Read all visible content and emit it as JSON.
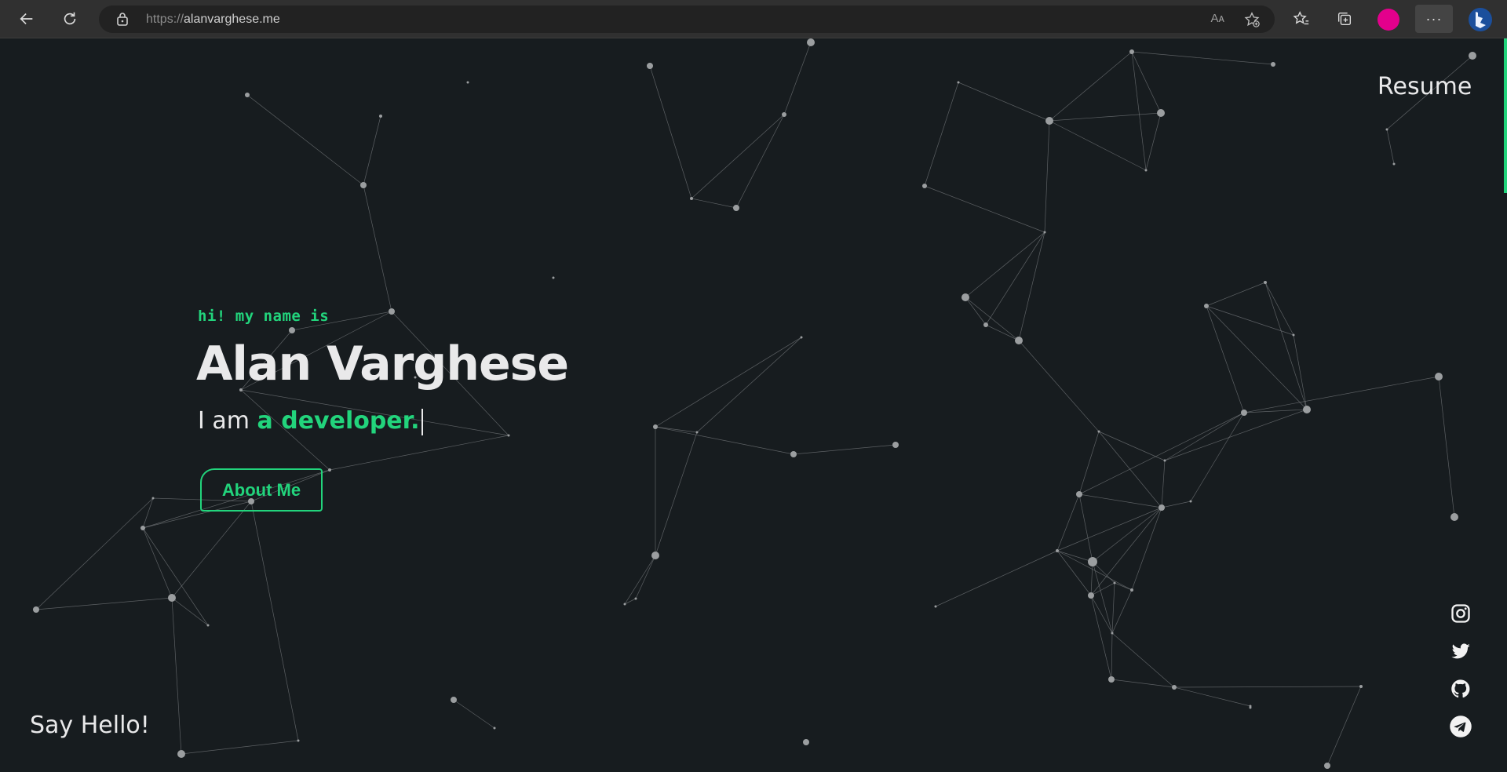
{
  "browser": {
    "url_protocol": "https://",
    "url_host": "alanvarghese.me",
    "read_aloud_icon": "Aᴀ"
  },
  "hero": {
    "greeting": "hi! my name is",
    "name": "Alan Varghese",
    "role_prefix": "I am ",
    "role_highlight": "a developer.",
    "about_button": "About Me"
  },
  "nav": {
    "resume": "Resume",
    "say_hello": "Say Hello!"
  },
  "socials": [
    "instagram-icon",
    "twitter-icon",
    "github-icon",
    "telegram-icon"
  ],
  "colors": {
    "accent": "#22d47c",
    "background": "#171c1f",
    "text": "#e9e9ea",
    "profile": "#e3008c"
  }
}
